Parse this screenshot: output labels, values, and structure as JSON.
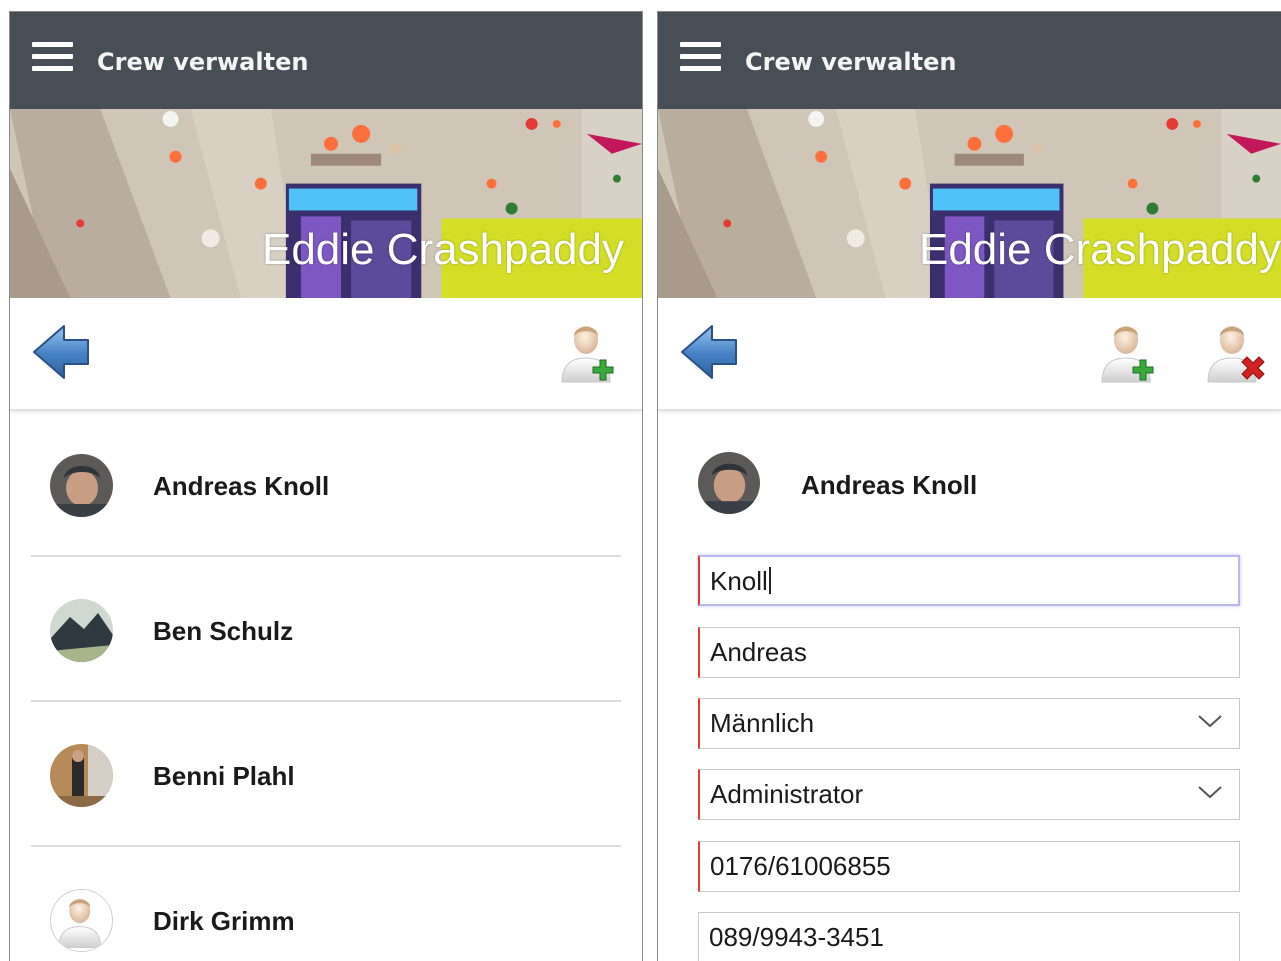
{
  "app": {
    "title": "Crew verwalten"
  },
  "banner": {
    "crew_name": "Eddie Crashpaddy"
  },
  "crew_list": {
    "members": [
      {
        "name": "Andreas Knoll",
        "avatar": "photo"
      },
      {
        "name": "Ben Schulz",
        "avatar": "photo"
      },
      {
        "name": "Benni Plahl",
        "avatar": "photo"
      },
      {
        "name": "Dirk Grimm",
        "avatar": "default-user-icon"
      }
    ]
  },
  "detail": {
    "member_name": "Andreas Knoll",
    "form": {
      "last_name": "Knoll",
      "first_name": "Andreas",
      "gender": "Männlich",
      "role": "Administrator",
      "mobile": "0176/61006855",
      "phone": "089/9943-3451"
    }
  },
  "icons": {
    "menu": "hamburger-menu-icon",
    "back": "back-arrow-icon",
    "add_user": "add-user-icon",
    "remove_user": "remove-user-icon",
    "dropdown": "chevron-down-icon"
  },
  "colors": {
    "topbar": "#474e55",
    "required_marker": "#e53935",
    "add_plus": "#3aa83a",
    "remove_x": "#d32020",
    "back_arrow": "#4a86c8"
  }
}
